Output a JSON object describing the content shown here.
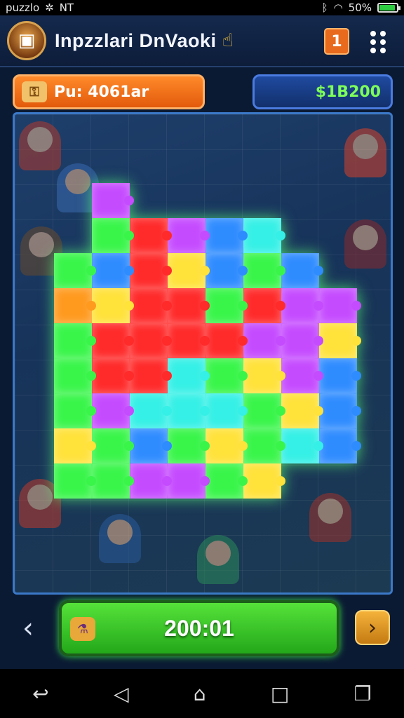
{
  "status_bar": {
    "app_name": "puzzlo",
    "extra_text": "NT",
    "battery_text": "50%",
    "battery_level": 0.9
  },
  "header": {
    "title": "Inpzzlari DnVaoki",
    "calendar_badge": "1"
  },
  "score": {
    "label": "Pu: 4061ar"
  },
  "coins": {
    "value": "$1B200"
  },
  "timer": {
    "value": "200:01"
  },
  "colors": {
    "green": "#39f54a",
    "red": "#ff2a2a",
    "blue": "#2f8cff",
    "yellow": "#ffe23a",
    "magenta": "#c54bff",
    "cyan": "#35f0e6",
    "orange": "#ff9a1f"
  },
  "puzzle": {
    "rows": [
      [
        "empty",
        "magenta",
        "empty",
        "empty",
        "empty",
        "empty",
        "empty",
        "empty"
      ],
      [
        "empty",
        "green",
        "red",
        "magenta",
        "blue",
        "cyan",
        "empty",
        "empty"
      ],
      [
        "green",
        "blue",
        "red",
        "yellow",
        "blue",
        "green",
        "blue",
        "empty"
      ],
      [
        "orange",
        "yellow",
        "red",
        "red",
        "green",
        "red",
        "magenta",
        "magenta"
      ],
      [
        "green",
        "red",
        "red",
        "red",
        "red",
        "magenta",
        "magenta",
        "yellow"
      ],
      [
        "green",
        "red",
        "red",
        "cyan",
        "green",
        "yellow",
        "magenta",
        "blue"
      ],
      [
        "green",
        "magenta",
        "cyan",
        "cyan",
        "cyan",
        "green",
        "yellow",
        "blue"
      ],
      [
        "yellow",
        "green",
        "blue",
        "green",
        "yellow",
        "green",
        "cyan",
        "blue"
      ],
      [
        "green",
        "green",
        "magenta",
        "magenta",
        "green",
        "yellow",
        "empty",
        "empty"
      ]
    ]
  },
  "icons": {
    "logo": "treasure-chest-icon",
    "hand": "pointing-hand-icon",
    "calendar": "calendar-icon",
    "menu": "menu-dots-icon",
    "key": "key-icon",
    "timer": "potion-icon",
    "prev": "chevron-left-icon",
    "next": "chevron-right-icon"
  }
}
